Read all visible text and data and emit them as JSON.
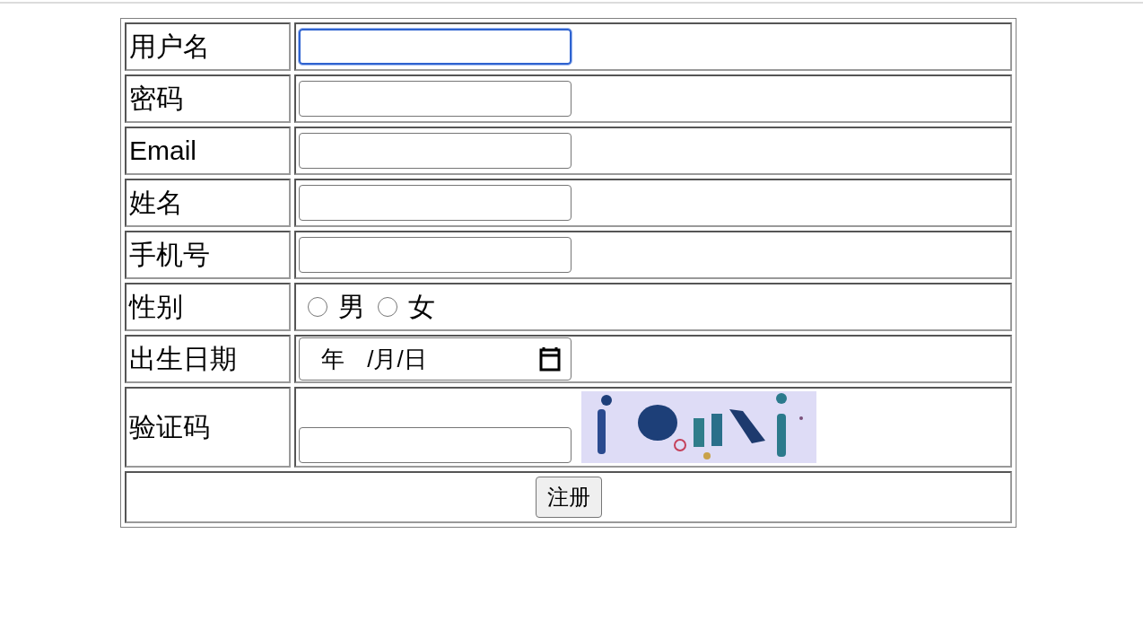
{
  "rows": [
    {
      "label": "用户名",
      "field": {
        "kind": "text",
        "focused": true
      }
    },
    {
      "label": "密码",
      "field": {
        "kind": "password",
        "focused": false
      }
    },
    {
      "label": "Email",
      "field": {
        "kind": "text",
        "focused": false
      }
    },
    {
      "label": "姓名",
      "field": {
        "kind": "text",
        "focused": false
      }
    },
    {
      "label": "手机号",
      "field": {
        "kind": "text",
        "focused": false
      }
    },
    {
      "label": "性别",
      "field": {
        "kind": "radio",
        "options": [
          {
            "label": "男",
            "selected": false
          },
          {
            "label": "女",
            "selected": false
          }
        ]
      }
    },
    {
      "label": "出生日期",
      "field": {
        "kind": "date",
        "placeholder": "年 /月/日"
      }
    },
    {
      "label": "验证码",
      "field": {
        "kind": "captcha",
        "focused": false
      }
    }
  ],
  "submit": "注册"
}
